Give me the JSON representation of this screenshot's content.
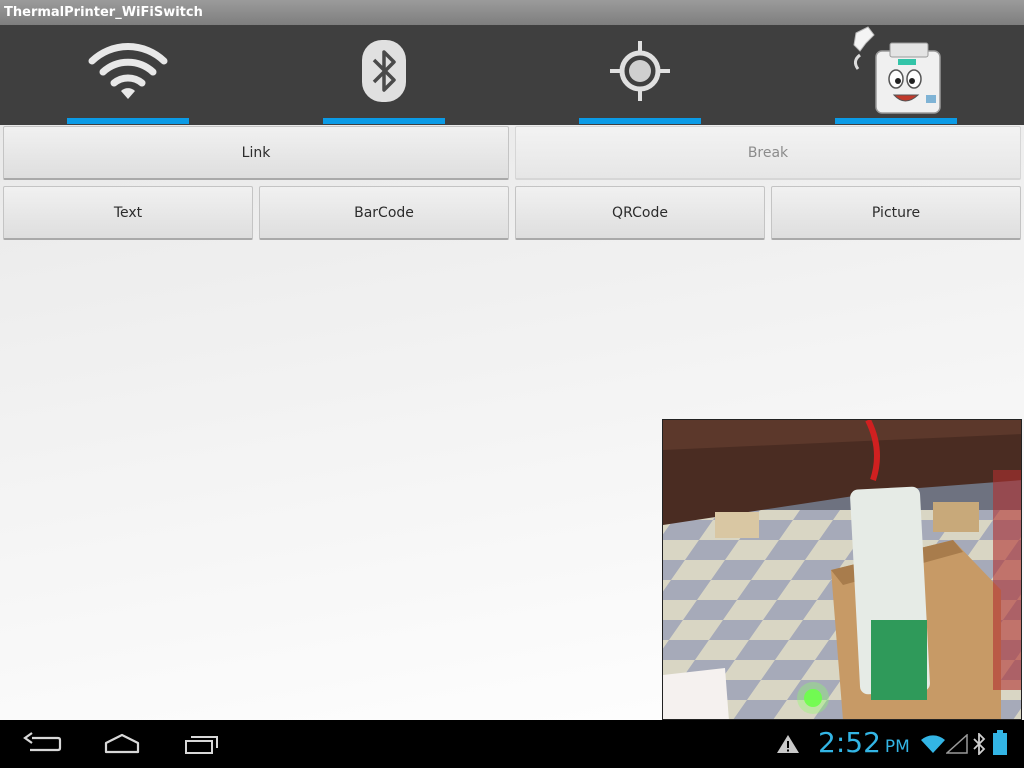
{
  "app": {
    "title": "ThermalPrinter_WiFiSwitch"
  },
  "tabs": [
    {
      "icon": "wifi-icon"
    },
    {
      "icon": "bluetooth-icon"
    },
    {
      "icon": "gps-target-icon"
    },
    {
      "icon": "printer-mascot-icon"
    }
  ],
  "buttons": {
    "link": "Link",
    "break": "Break",
    "text": "Text",
    "barcode": "BarCode",
    "qrcode": "QRCode",
    "picture": "Picture"
  },
  "colors": {
    "accent": "#0b9be6",
    "clock": "#33b5e5",
    "tabbar": "#3f3f3f"
  },
  "statusbar": {
    "time": "2:52",
    "ampm": "PM",
    "icons": [
      "warning-icon",
      "wifi-signal-icon",
      "cell-signal-icon",
      "bluetooth-icon",
      "battery-icon"
    ]
  },
  "navbar": {
    "icons": [
      "back-icon",
      "home-icon",
      "recent-apps-icon"
    ]
  }
}
